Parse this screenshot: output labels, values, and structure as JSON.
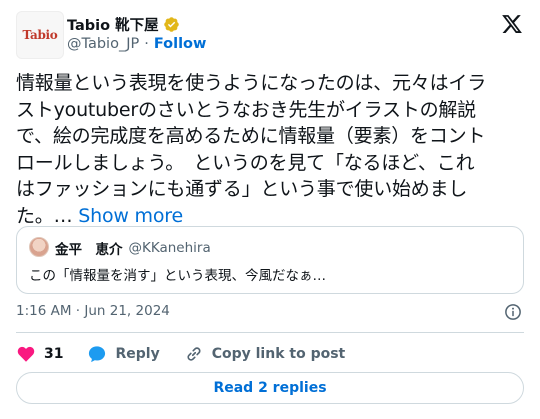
{
  "author": {
    "avatar_text": "Tabio",
    "name": "Tabio 靴下屋",
    "handle": "@Tabio_JP",
    "separator": "·",
    "follow_label": "Follow"
  },
  "tweet": {
    "lines": [
      "情報量という表現を使うようになったのは、元々はイラ",
      "ストyoutuberのさいとうなおき先生がイラストの解説",
      "で、絵の完成度を高めるために情報量（要素）をコント",
      "ロールしましょう。　というのを見て「なるほど、これ",
      "はファッションにも通ずる」という事で使い始めまし"
    ],
    "last_line": "た。…",
    "show_more": "Show more"
  },
  "quote": {
    "name": "金平　恵介",
    "handle": "@KKanehira",
    "text": "この「情報量を消す」という表現、今風だなぁ…"
  },
  "meta": {
    "timestamp": "1:16 AM · Jun 21, 2024"
  },
  "actions": {
    "likes_count": "31",
    "reply_label": "Reply",
    "copy_label": "Copy link to post"
  },
  "replies_label": "Read 2 replies",
  "colors": {
    "link": "#006fd6",
    "like": "#f91880",
    "verified": "#e2b719",
    "reply_icon": "#1d9bf0"
  },
  "icons": [
    "verified-badge-icon",
    "x-logo-icon",
    "info-icon",
    "heart-icon",
    "reply-bubble-icon",
    "link-icon"
  ]
}
